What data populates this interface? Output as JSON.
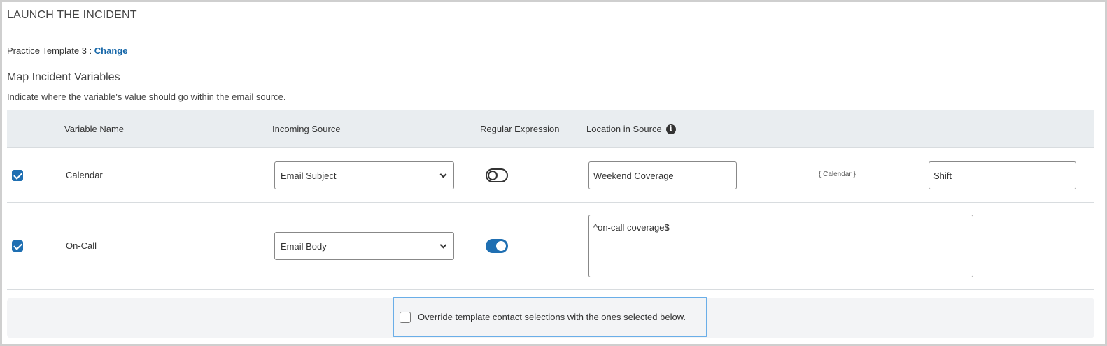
{
  "header": {
    "title": "LAUNCH THE INCIDENT"
  },
  "template": {
    "name": "Practice Template 3",
    "separator": " : ",
    "change_label": "Change"
  },
  "section": {
    "title": "Map Incident Variables",
    "description": "Indicate where the variable's value should go within the email source."
  },
  "table": {
    "headers": {
      "variable_name": "Variable Name",
      "incoming_source": "Incoming Source",
      "regular_expression": "Regular Expression",
      "location_in_source": "Location in Source"
    },
    "rows": [
      {
        "checked": true,
        "variable_name": "Calendar",
        "incoming_source": "Email Subject",
        "regex_enabled": false,
        "location_before": "Weekend Coverage",
        "token": "{ Calendar }",
        "location_after": "Shift"
      },
      {
        "checked": true,
        "variable_name": "On-Call",
        "incoming_source": "Email Body",
        "regex_enabled": true,
        "regex_value": "^on-call coverage$"
      }
    ]
  },
  "override": {
    "checked": false,
    "label": "Override template contact selections with the ones selected below."
  },
  "icons": {
    "info": "info-circle-icon",
    "dropdown": "chevron-down-icon",
    "check": "checkmark-icon"
  },
  "colors": {
    "accent": "#1f6fb2",
    "link": "#1566a8",
    "header_bg": "#e9edf0",
    "highlight_border": "#6aaee8"
  }
}
